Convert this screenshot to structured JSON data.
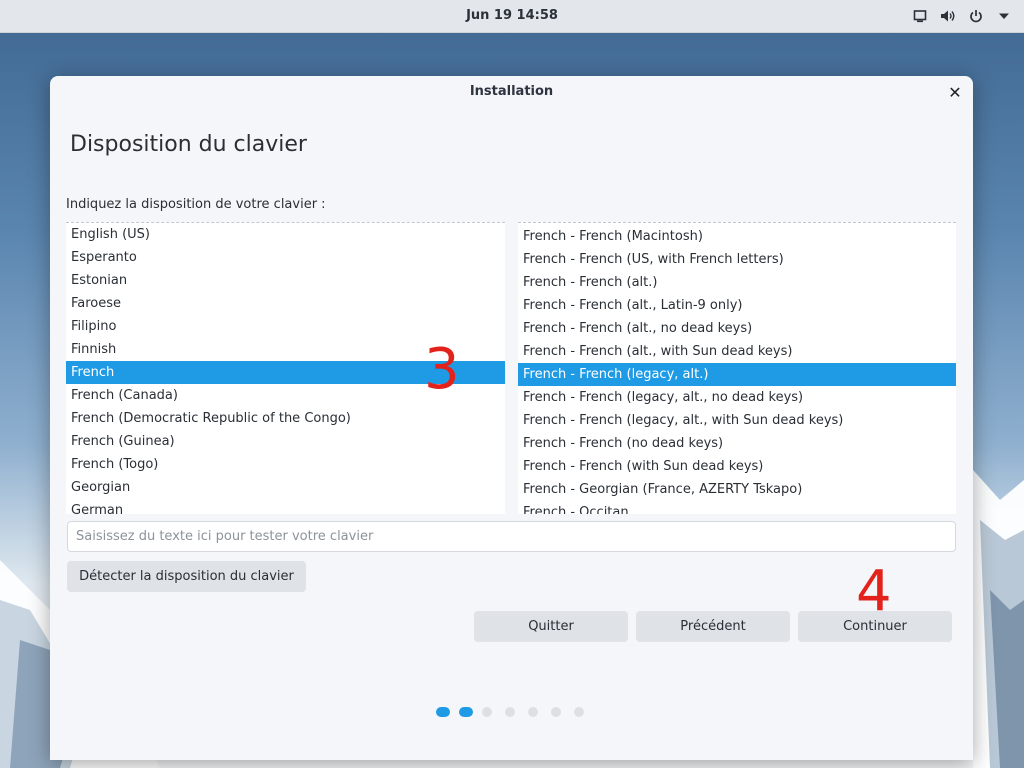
{
  "topbar": {
    "datetime": "Jun 19  14:58",
    "icons": [
      "screen-icon",
      "volume-icon",
      "power-icon",
      "chevron-down-icon"
    ]
  },
  "window": {
    "title": "Installation",
    "close_glyph": "✕"
  },
  "page": {
    "title": "Disposition du clavier",
    "prompt": "Indiquez la disposition de votre clavier :"
  },
  "languages": {
    "selected": "French",
    "items": [
      "English (US)",
      "Esperanto",
      "Estonian",
      "Faroese",
      "Filipino",
      "Finnish",
      "French",
      "French (Canada)",
      "French (Democratic Republic of the Congo)",
      "French (Guinea)",
      "French (Togo)",
      "Georgian",
      "German"
    ]
  },
  "variants": {
    "selected": "French - French (legacy, alt.)",
    "items": [
      "French - French (Macintosh)",
      "French - French (US, with French letters)",
      "French - French (alt.)",
      "French - French (alt., Latin-9 only)",
      "French - French (alt., no dead keys)",
      "French - French (alt., with Sun dead keys)",
      "French - French (legacy, alt.)",
      "French - French (legacy, alt., no dead keys)",
      "French - French (legacy, alt., with Sun dead keys)",
      "French - French (no dead keys)",
      "French - French (with Sun dead keys)",
      "French - Georgian (France, AZERTY Tskapo)",
      "French - Occitan"
    ]
  },
  "test_input": {
    "placeholder": "Saisissez du texte ici pour tester votre clavier",
    "value": ""
  },
  "buttons": {
    "detect": "Détecter la disposition du clavier",
    "quit": "Quitter",
    "previous": "Précédent",
    "continue": "Continuer"
  },
  "annotations": {
    "step3": "3",
    "step4": "4",
    "color": "#e3221b"
  },
  "progress": {
    "total_steps": 7,
    "active_steps": 2,
    "active_color": "#1f9be6"
  },
  "colors": {
    "accent": "#1f9be6",
    "window_bg": "#f5f6fa",
    "button_bg": "#dfe2e7"
  }
}
